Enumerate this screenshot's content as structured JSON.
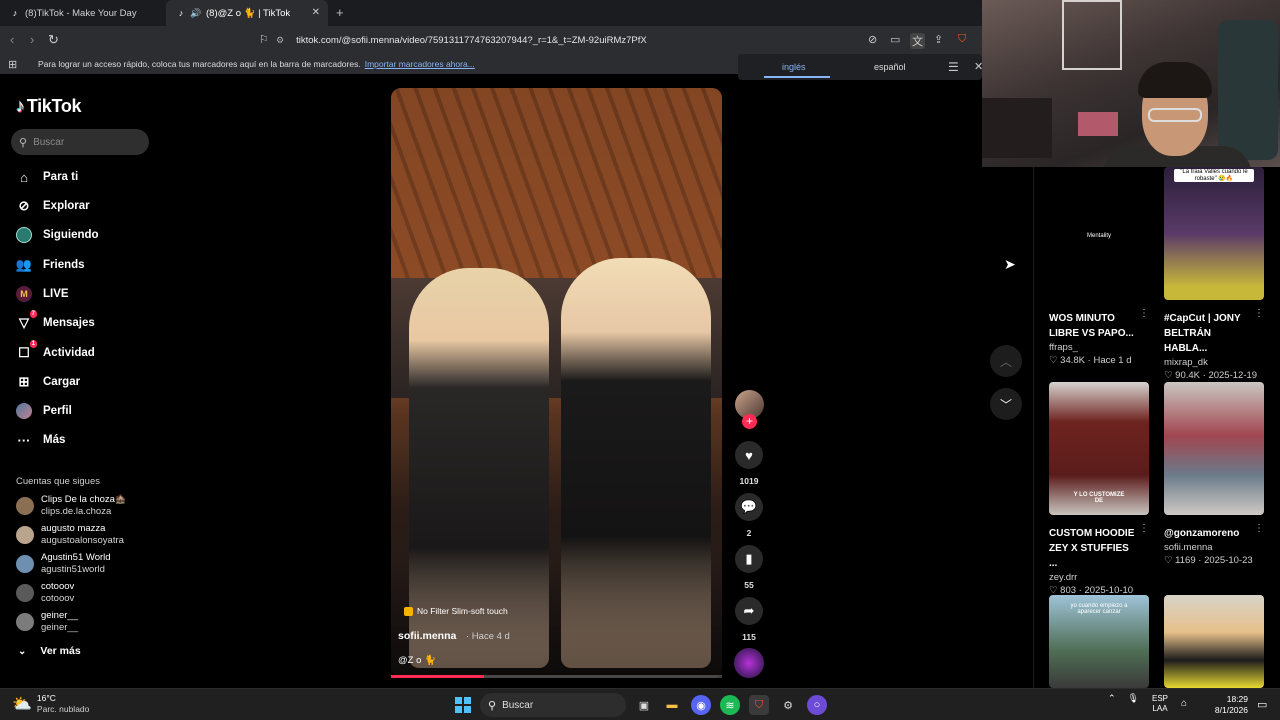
{
  "browser": {
    "tabs": [
      {
        "title": "(8)TikTok - Make Your Day"
      },
      {
        "title": "(8)@Z o 🐈 | TikTok"
      }
    ],
    "url": "tiktok.com/@sofii.menna/video/7591311774763207944?_r=1&_t=ZM-92uiRMz7PfX",
    "bookmarks_text": "Para lograr un acceso rápido, coloca tus marcadores aquí en la barra de marcadores.",
    "bookmarks_link": "Importar marcadores ahora...",
    "translate": {
      "lang_a": "inglés",
      "lang_b": "español"
    }
  },
  "sidebar": {
    "logo": "TikTok",
    "search_placeholder": "Buscar",
    "nav": [
      {
        "label": "Para ti",
        "icon": "home-icon"
      },
      {
        "label": "Explorar",
        "icon": "compass-icon"
      },
      {
        "label": "Siguiendo",
        "icon": "following-icon"
      },
      {
        "label": "Friends",
        "icon": "friends-icon"
      },
      {
        "label": "LIVE",
        "icon": "live-icon"
      },
      {
        "label": "Mensajes",
        "icon": "messages-icon",
        "badge": "7"
      },
      {
        "label": "Actividad",
        "icon": "activity-icon",
        "badge": "1"
      },
      {
        "label": "Cargar",
        "icon": "upload-icon"
      },
      {
        "label": "Perfil",
        "icon": "profile-icon"
      },
      {
        "label": "Más",
        "icon": "more-icon"
      }
    ],
    "following_title": "Cuentas que sigues",
    "accounts": [
      {
        "name": "Clips De la choza🏚️",
        "handle": "clips.de.la.choza"
      },
      {
        "name": "augusto mazza",
        "handle": "augustoalonsoyatra"
      },
      {
        "name": "Agustin51 World",
        "handle": "agustin51world"
      },
      {
        "name": "cotooov",
        "handle": "cotooov"
      },
      {
        "name": "geiner__",
        "handle": "geiner__"
      }
    ],
    "see_more": "Ver más"
  },
  "video": {
    "filter": "No Filter Slim-soft touch",
    "author": "sofii.menna",
    "time": "· Hace 4 d",
    "caption": "@Z o 🐈",
    "progress": 0.28,
    "likes": "1019",
    "comments": "2",
    "saves": "55",
    "shares": "115"
  },
  "related": [
    {
      "title": "WOS MINUTO LIBRE VS PAPO...",
      "author": "ffraps_",
      "views": "34.8K",
      "date": "Hace 1 d",
      "thumb_text": "Mentality"
    },
    {
      "title": "#CapCut | JONY BELTRÁN HABLA...",
      "author": "mixrap_dk",
      "views": "90.4K",
      "date": "2025-12-19",
      "thumb_text": "\"La traia Valles cuando le robaste\" 😢🔥"
    },
    {
      "title": "CUSTOM HOODIE ZEY X STUFFIES ...",
      "author": "zey.drr",
      "views": "803",
      "date": "2025-10-10",
      "thumb_text": "Y LO CUSTOMIZE DE"
    },
    {
      "title": "@gonzamoreno",
      "author": "sofii.menna",
      "views": "1169",
      "date": "2025-10-23",
      "thumb_text": ""
    },
    {
      "title": "",
      "author": "",
      "views": "",
      "date": "",
      "thumb_text": "yo cuando empiezo a aparecer canzar"
    },
    {
      "title": "",
      "author": "",
      "views": "",
      "date": "",
      "thumb_text": ""
    }
  ],
  "taskbar": {
    "temp": "16°C",
    "condition": "Parc. nublado",
    "search": "Buscar",
    "lang1": "ESP",
    "lang2": "LAA",
    "time": "18:29",
    "date": "8/1/2026"
  }
}
